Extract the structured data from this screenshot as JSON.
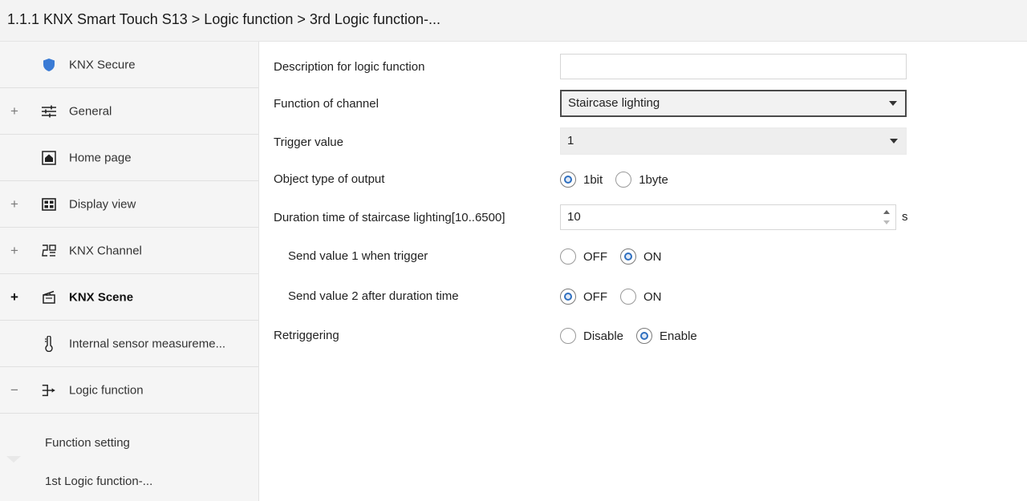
{
  "header": {
    "title": "1.1.1 KNX Smart Touch S13 > Logic function > 3rd Logic function-..."
  },
  "sidebar": {
    "items": [
      {
        "expander": "",
        "icon": "shield-icon",
        "label": "KNX Secure"
      },
      {
        "expander": "+",
        "icon": "sliders-icon",
        "label": "General"
      },
      {
        "expander": "",
        "icon": "home-icon",
        "label": "Home page"
      },
      {
        "expander": "+",
        "icon": "grid-icon",
        "label": "Display view"
      },
      {
        "expander": "+",
        "icon": "channel-icon",
        "label": "KNX Channel"
      },
      {
        "expander": "+",
        "icon": "scene-icon",
        "label": "KNX Scene"
      },
      {
        "expander": "",
        "icon": "thermometer-icon",
        "label": "Internal sensor measureme..."
      },
      {
        "expander": "−",
        "icon": "logic-icon",
        "label": "Logic function"
      }
    ],
    "sub_items": [
      "Function setting",
      "1st Logic function-..."
    ]
  },
  "params": {
    "description_label": "Description for logic function",
    "description_value": "",
    "function_label": "Function of channel",
    "function_value": "Staircase lighting",
    "trigger_label": "Trigger value",
    "trigger_value": "1",
    "object_type_label": "Object type of  output",
    "object_type_options": [
      "1bit",
      "1byte"
    ],
    "object_type_selected": "1bit",
    "duration_label": "Duration time of staircase lighting[10..6500]",
    "duration_value": "10",
    "duration_unit": "s",
    "send1_label": "Send value 1 when trigger",
    "send1_options": [
      "OFF",
      "ON"
    ],
    "send1_selected": "ON",
    "send2_label": "Send value 2 after duration time",
    "send2_options": [
      "OFF",
      "ON"
    ],
    "send2_selected": "OFF",
    "retrigger_label": "Retriggering",
    "retrigger_options": [
      "Disable",
      "Enable"
    ],
    "retrigger_selected": "Enable"
  },
  "colors": {
    "accent": "#2f6fbf",
    "shield": "#3a7bd5"
  }
}
